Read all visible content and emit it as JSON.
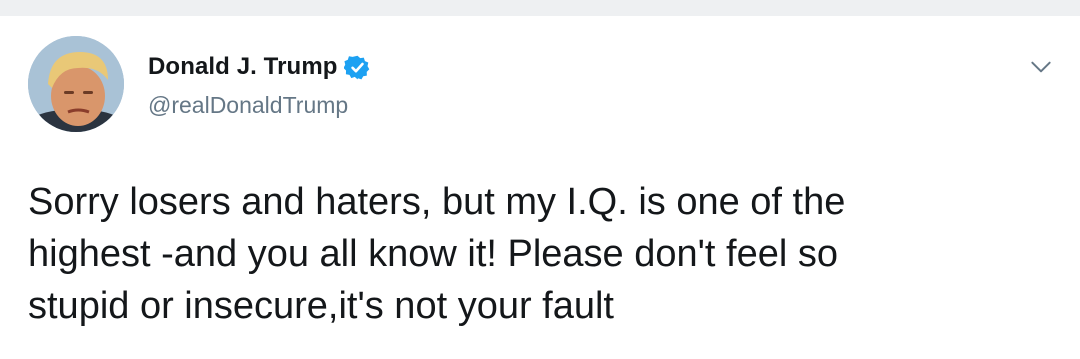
{
  "tweet": {
    "author": {
      "display_name": "Donald J. Trump",
      "handle": "@realDonaldTrump",
      "verified": true,
      "verified_icon": "verified-badge-icon",
      "avatar_icon": "profile-photo"
    },
    "text_lines": [
      "Sorry losers and haters, but my I.Q. is one of the",
      "highest -and you all know it! Please don't feel so",
      "stupid or insecure,it's not your fault"
    ],
    "menu_icon": "chevron-down-icon"
  },
  "colors": {
    "verified_blue": "#1da1f2",
    "text_primary": "#14171a",
    "text_secondary": "#657786",
    "top_strip": "#eef0f2"
  }
}
